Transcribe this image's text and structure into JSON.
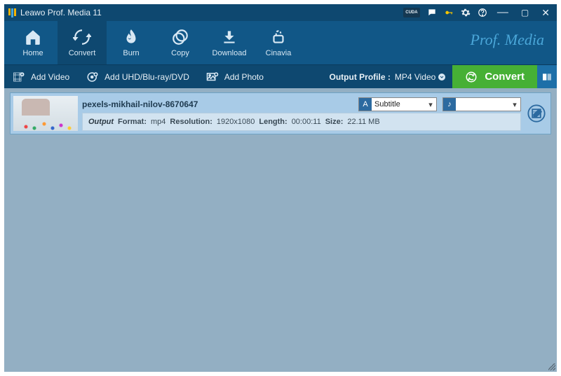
{
  "window": {
    "title": "Leawo Prof. Media 11",
    "brand": "Prof. Media",
    "cuda": "CUDA"
  },
  "nav": {
    "home": "Home",
    "convert": "Convert",
    "burn": "Burn",
    "copy": "Copy",
    "download": "Download",
    "cinavia": "Cinavia"
  },
  "actions": {
    "add_video": "Add Video",
    "add_disc": "Add UHD/Blu-ray/DVD",
    "add_photo": "Add Photo",
    "output_profile_label": "Output Profile :",
    "output_profile_value": "MP4 Video",
    "convert": "Convert"
  },
  "item": {
    "filename": "pexels-mikhail-nilov-8670647",
    "subtitle": "Subtitle",
    "output_label": "Output",
    "format_label": "Format:",
    "format": "mp4",
    "resolution_label": "Resolution:",
    "resolution": "1920x1080",
    "length_label": "Length:",
    "length": "00:00:11",
    "size_label": "Size:",
    "size": "22.11 MB"
  }
}
